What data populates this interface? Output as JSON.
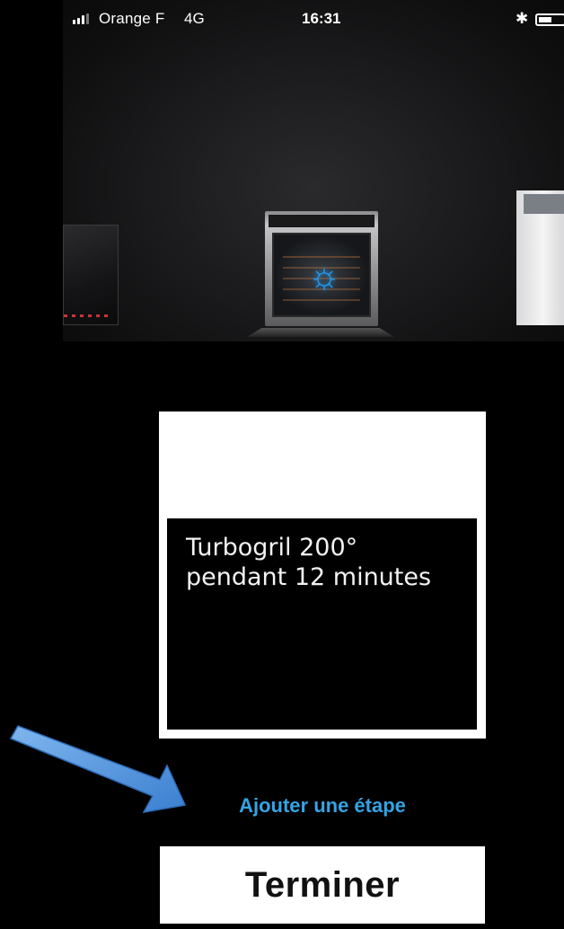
{
  "status_bar": {
    "carrier": "Orange F",
    "network": "4G",
    "time": "16:31"
  },
  "card": {
    "instruction": "Turbogril 200°\npendant 12 minutes"
  },
  "actions": {
    "add_step_label": "Ajouter une étape",
    "finish_label": "Terminer"
  },
  "colors": {
    "background": "#000000",
    "accent_link": "#35a4e4",
    "oven_icon_glow": "#1ea1ff",
    "annotation_arrow": "#4a90d9"
  },
  "icons": {
    "signal": "signal-strength-icon",
    "bluetooth": "bluetooth-icon",
    "battery": "battery-icon",
    "oven_mode": "turbogril-mode-icon"
  }
}
